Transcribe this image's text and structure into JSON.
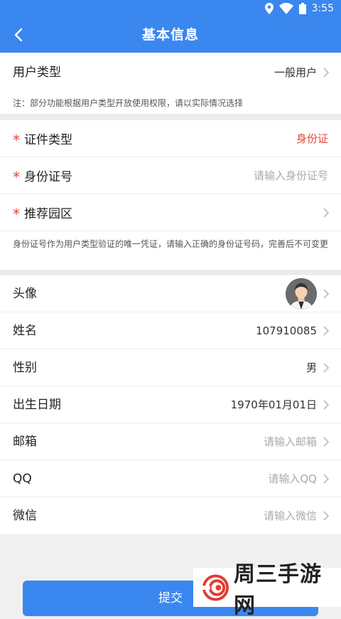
{
  "status_bar": {
    "time": "3:55",
    "icons": [
      "location-icon",
      "wifi-icon",
      "battery-icon"
    ]
  },
  "nav": {
    "title": "基本信息",
    "back_icon": "chevron-left-icon"
  },
  "section1": {
    "user_type": {
      "label": "用户类型",
      "value": "一般用户"
    },
    "note": "注：部分功能根据用户类型开放使用权限，请以实际情况选择"
  },
  "section2": {
    "id_type": {
      "required": "*",
      "label": "证件类型",
      "value": "身份证"
    },
    "id_number": {
      "required": "*",
      "label": "身份证号",
      "placeholder": "请输入身份证号"
    },
    "park": {
      "required": "*",
      "label": "推荐园区",
      "value": ""
    },
    "note": "身份证号作为用户类型验证的唯一凭证，请输入正确的身份证号码，完善后不可变更"
  },
  "section3": {
    "avatar": {
      "label": "头像"
    },
    "name": {
      "label": "姓名",
      "value": "107910085"
    },
    "gender": {
      "label": "性别",
      "value": "男"
    },
    "birthday": {
      "label": "出生日期",
      "value": "1970年01月01日"
    },
    "email": {
      "label": "邮箱",
      "placeholder": "请输入邮箱"
    },
    "qq": {
      "label": "QQ",
      "placeholder": "请输入QQ"
    },
    "wechat": {
      "label": "微信",
      "placeholder": "请输入微信"
    }
  },
  "submit_label": "提交",
  "watermark": {
    "text": "周三手游网"
  },
  "colors": {
    "primary": "#3a87ef",
    "required": "#e0463c",
    "placeholder": "#aaaaaa"
  }
}
